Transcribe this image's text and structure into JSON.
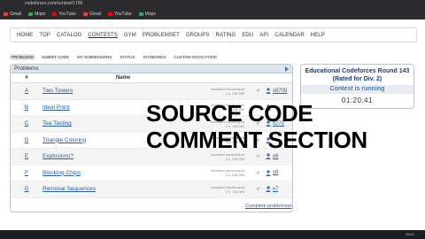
{
  "browser": {
    "url": "codeforces.com/contest/1795",
    "bookmarks": [
      {
        "label": "Gmail",
        "color": "#ea4335"
      },
      {
        "label": "Maps",
        "color": "#34a853"
      },
      {
        "label": "YouTube",
        "color": "#ff0000"
      },
      {
        "label": "Gmail",
        "color": "#ea4335"
      },
      {
        "label": "YouTube",
        "color": "#ff0000"
      },
      {
        "label": "Maps",
        "color": "#34a853"
      }
    ]
  },
  "nav": {
    "items": [
      {
        "label": "HOME",
        "name": "home"
      },
      {
        "label": "TOP",
        "name": "top"
      },
      {
        "label": "CATALOG",
        "name": "catalog"
      },
      {
        "label": "CONTESTS",
        "name": "contests"
      },
      {
        "label": "GYM",
        "name": "gym"
      },
      {
        "label": "PROBLEMSET",
        "name": "problemset"
      },
      {
        "label": "GROUPS",
        "name": "groups"
      },
      {
        "label": "RATING",
        "name": "rating"
      },
      {
        "label": "EDU",
        "name": "edu"
      },
      {
        "label": "API",
        "name": "api"
      },
      {
        "label": "CALENDAR",
        "name": "calendar"
      },
      {
        "label": "HELP",
        "name": "help"
      }
    ]
  },
  "subtabs": [
    {
      "label": "PROBLEMS",
      "name": "problems"
    },
    {
      "label": "SUBMIT CODE",
      "name": "submit-code"
    },
    {
      "label": "MY SUBMISSIONS",
      "name": "my-submissions"
    },
    {
      "label": "STATUS",
      "name": "status"
    },
    {
      "label": "STANDINGS",
      "name": "standings"
    },
    {
      "label": "CUSTOM INVOCATION",
      "name": "custom-invocation"
    }
  ],
  "problems": {
    "panel_title": "Problems",
    "col_hash": "#",
    "col_name": "Name",
    "rows": [
      {
        "id": "A",
        "name": "Two Towers",
        "io": "standard input/output",
        "limits": "2 s, 256 MB",
        "solved": "x8709"
      },
      {
        "id": "B",
        "name": "Ideal Point",
        "io": "standard input/output",
        "limits": "2 s, 256 MB",
        "solved": ""
      },
      {
        "id": "C",
        "name": "Tea Tasting",
        "io": "standard input/output",
        "limits": "2 s, 256 MB",
        "solved": "x271"
      },
      {
        "id": "D",
        "name": "Triangle Coloring",
        "io": "standard input/output",
        "limits": "4 s, 512 MB",
        "solved": ""
      },
      {
        "id": "E",
        "name": "Explosions?",
        "io": "standard input/output",
        "limits": "2 s, 256 MB",
        "solved": "x6"
      },
      {
        "id": "F",
        "name": "Blocking Chips",
        "io": "standard input/output",
        "limits": "3 s, 256 MB",
        "solved": "x8"
      },
      {
        "id": "G",
        "name": "Removal Sequences",
        "io": "standard input/output",
        "limits": "2 s, 256 MB",
        "solved": "x7"
      }
    ],
    "complete_link": "Complete problemset"
  },
  "sidebar": {
    "title": "Educational Codeforces Round 143 (Rated for Div. 2)",
    "status": "Contest is running",
    "timer": "01:20:41"
  },
  "overlay": {
    "line1": "SOURCE CODE",
    "line2": "COMMENT SECTION"
  },
  "taskbar": {
    "time": "19:41"
  }
}
